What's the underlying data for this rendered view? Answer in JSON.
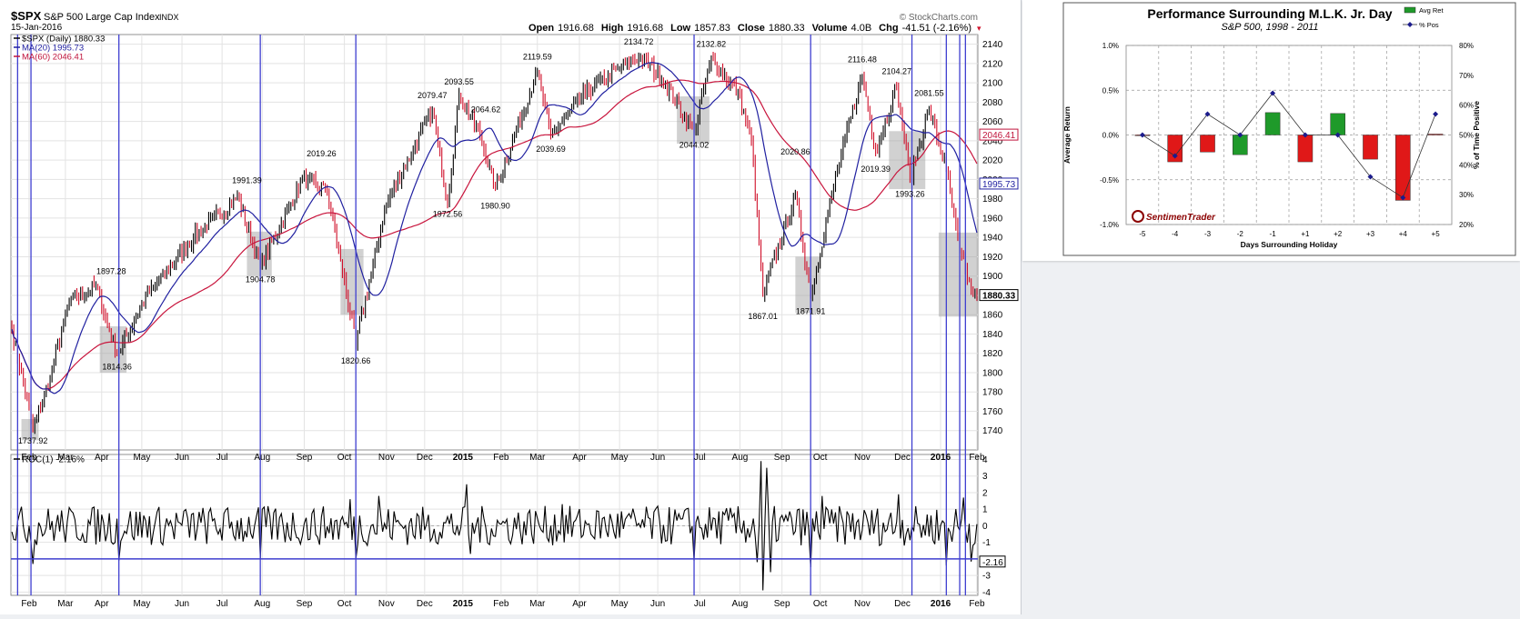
{
  "stockcharts": {
    "symbol": "$SPX",
    "name": "S&P 500 Large Cap Index",
    "exchange": "INDX",
    "date": "15-Jan-2016",
    "watermark": "© StockCharts.com",
    "quote": {
      "open_label": "Open",
      "open": "1916.68",
      "high_label": "High",
      "high": "1916.68",
      "low_label": "Low",
      "low": "1857.83",
      "close_label": "Close",
      "close": "1880.33",
      "volume_label": "Volume",
      "volume": "4.0B",
      "chg_label": "Chg",
      "chg": "-41.51 (-2.16%)"
    },
    "legend": [
      {
        "text": "$SPX (Daily) 1880.33",
        "color": "#000000"
      },
      {
        "text": "MA(20) 1995.73",
        "color": "#1f1fa0"
      },
      {
        "text": "MA(60) 2046.41",
        "color": "#c0143c"
      }
    ],
    "roc_label": "ROC(1) -2.16%",
    "value_tags": [
      {
        "text": "2046.41",
        "value": 2046.41,
        "color": "#c0143c"
      },
      {
        "text": "1995.73",
        "value": 1995.73,
        "color": "#1f1fa0"
      },
      {
        "text": "1880.33",
        "value": 1880.33,
        "color": "#000000"
      }
    ],
    "roc_tag": {
      "text": "-2.16",
      "value": -2.16
    },
    "price_axis": {
      "min": 1720,
      "max": 2150,
      "ticks": [
        2140,
        2120,
        2100,
        2080,
        2060,
        2040,
        2020,
        2000,
        1980,
        1960,
        1940,
        1920,
        1900,
        1880,
        1860,
        1840,
        1820,
        1800,
        1780,
        1760,
        1740
      ]
    },
    "roc_axis": {
      "min": -4.2,
      "max": 4.3,
      "ticks": [
        4,
        3,
        2,
        1,
        0,
        -1,
        -2,
        -3,
        -4
      ]
    },
    "x_labels": [
      {
        "text": "Feb",
        "idx": 9
      },
      {
        "text": "Mar",
        "idx": 28
      },
      {
        "text": "Apr",
        "idx": 47
      },
      {
        "text": "May",
        "idx": 68
      },
      {
        "text": "Jun",
        "idx": 89
      },
      {
        "text": "Jul",
        "idx": 110
      },
      {
        "text": "Aug",
        "idx": 131
      },
      {
        "text": "Sep",
        "idx": 153
      },
      {
        "text": "Oct",
        "idx": 174
      },
      {
        "text": "Nov",
        "idx": 196
      },
      {
        "text": "Dec",
        "idx": 216
      },
      {
        "text": "2015",
        "idx": 236,
        "bold": true
      },
      {
        "text": "Feb",
        "idx": 256
      },
      {
        "text": "Mar",
        "idx": 275
      },
      {
        "text": "Apr",
        "idx": 297
      },
      {
        "text": "May",
        "idx": 318
      },
      {
        "text": "Jun",
        "idx": 338
      },
      {
        "text": "Jul",
        "idx": 360
      },
      {
        "text": "Aug",
        "idx": 381
      },
      {
        "text": "Sep",
        "idx": 403
      },
      {
        "text": "Oct",
        "idx": 423
      },
      {
        "text": "Nov",
        "idx": 445
      },
      {
        "text": "Dec",
        "idx": 466
      },
      {
        "text": "2016",
        "idx": 486,
        "bold": true
      },
      {
        "text": "Feb",
        "idx": 505
      }
    ],
    "vertical_markers": [
      3,
      10,
      56,
      130,
      180,
      357,
      418,
      471,
      489,
      496,
      499
    ],
    "roc_hline": -2.0,
    "shaded_boxes": [
      {
        "i0": 5,
        "i1": 14,
        "lo": 1730,
        "hi": 1752
      },
      {
        "i0": 46,
        "i1": 60,
        "lo": 1800,
        "hi": 1848
      },
      {
        "i0": 123,
        "i1": 136,
        "lo": 1900,
        "hi": 1946
      },
      {
        "i0": 172,
        "i1": 184,
        "lo": 1860,
        "hi": 1928
      },
      {
        "i0": 348,
        "i1": 365,
        "lo": 2037,
        "hi": 2086
      },
      {
        "i0": 410,
        "i1": 423,
        "lo": 1862,
        "hi": 1920
      },
      {
        "i0": 459,
        "i1": 478,
        "lo": 1990,
        "hi": 2050
      },
      {
        "i0": 485,
        "i1": 505,
        "lo": 1858,
        "hi": 1945
      }
    ],
    "price_labels": [
      {
        "text": "1737.92",
        "idx": 11,
        "value": 1737.92,
        "pos": "below"
      },
      {
        "text": "1897.28",
        "idx": 52,
        "value": 1897.28,
        "pos": "above"
      },
      {
        "text": "1814.36",
        "idx": 55,
        "value": 1814.36,
        "pos": "below"
      },
      {
        "text": "1991.39",
        "idx": 123,
        "value": 1991.39,
        "pos": "above"
      },
      {
        "text": "1904.78",
        "idx": 130,
        "value": 1904.78,
        "pos": "below"
      },
      {
        "text": "2019.26",
        "idx": 162,
        "value": 2019.26,
        "pos": "above"
      },
      {
        "text": "1820.66",
        "idx": 180,
        "value": 1820.66,
        "pos": "below"
      },
      {
        "text": "2079.47",
        "idx": 220,
        "value": 2079.47,
        "pos": "above"
      },
      {
        "text": "1972.56",
        "idx": 228,
        "value": 1972.56,
        "pos": "below"
      },
      {
        "text": "2093.55",
        "idx": 234,
        "value": 2093.55,
        "pos": "above"
      },
      {
        "text": "2064.62",
        "idx": 248,
        "value": 2064.62,
        "pos": "above"
      },
      {
        "text": "1980.90",
        "idx": 253,
        "value": 1980.9,
        "pos": "below"
      },
      {
        "text": "2119.59",
        "idx": 275,
        "value": 2119.59,
        "pos": "above"
      },
      {
        "text": "2039.69",
        "idx": 282,
        "value": 2039.69,
        "pos": "below"
      },
      {
        "text": "2134.72",
        "idx": 328,
        "value": 2134.72,
        "pos": "above"
      },
      {
        "text": "2132.82",
        "idx": 366,
        "value": 2132.82,
        "pos": "above"
      },
      {
        "text": "2044.02",
        "idx": 357,
        "value": 2044.02,
        "pos": "below"
      },
      {
        "text": "1867.01",
        "idx": 393,
        "value": 1867.01,
        "pos": "below"
      },
      {
        "text": "2020.86",
        "idx": 410,
        "value": 2020.86,
        "pos": "above"
      },
      {
        "text": "1871.91",
        "idx": 418,
        "value": 1871.91,
        "pos": "below"
      },
      {
        "text": "2116.48",
        "idx": 445,
        "value": 2116.48,
        "pos": "above"
      },
      {
        "text": "2019.39",
        "idx": 452,
        "value": 2019.39,
        "pos": "below"
      },
      {
        "text": "2104.27",
        "idx": 463,
        "value": 2104.27,
        "pos": "above"
      },
      {
        "text": "2081.55",
        "idx": 480,
        "value": 2081.55,
        "pos": "above"
      },
      {
        "text": "1993.26",
        "idx": 470,
        "value": 1993.26,
        "pos": "below"
      }
    ],
    "colors": {
      "up": "#000000",
      "down": "#d0102a",
      "ma20": "#2020a0",
      "ma60": "#c8143c",
      "marker": "#3f3fd0",
      "grid": "#e3e3e3",
      "shade": "#9a9a9a"
    }
  },
  "chart_data": [
    {
      "type": "line",
      "title": "$SPX S&P 500 Large Cap Index",
      "x_range": [
        "Jan 2014",
        "Jan 2016"
      ],
      "ylim": [
        1720,
        2150
      ],
      "series": [
        {
          "name": "$SPX (Daily)",
          "last": 1880.33
        },
        {
          "name": "MA(20)",
          "last": 1995.73
        },
        {
          "name": "MA(60)",
          "last": 2046.41
        }
      ],
      "anchors": [
        {
          "idx": 0,
          "value": 1845
        },
        {
          "idx": 11,
          "value": 1741
        },
        {
          "idx": 20,
          "value": 1795
        },
        {
          "idx": 30,
          "value": 1872
        },
        {
          "idx": 44,
          "value": 1890
        },
        {
          "idx": 55,
          "value": 1818
        },
        {
          "idx": 70,
          "value": 1878
        },
        {
          "idx": 95,
          "value": 1940
        },
        {
          "idx": 118,
          "value": 1982
        },
        {
          "idx": 130,
          "value": 1910
        },
        {
          "idx": 152,
          "value": 2000
        },
        {
          "idx": 165,
          "value": 1988
        },
        {
          "idx": 180,
          "value": 1830
        },
        {
          "idx": 196,
          "value": 1975
        },
        {
          "idx": 220,
          "value": 2072
        },
        {
          "idx": 228,
          "value": 1976
        },
        {
          "idx": 234,
          "value": 2088
        },
        {
          "idx": 245,
          "value": 2045
        },
        {
          "idx": 253,
          "value": 1990
        },
        {
          "idx": 275,
          "value": 2112
        },
        {
          "idx": 282,
          "value": 2045
        },
        {
          "idx": 300,
          "value": 2090
        },
        {
          "idx": 328,
          "value": 2128
        },
        {
          "idx": 340,
          "value": 2105
        },
        {
          "idx": 357,
          "value": 2050
        },
        {
          "idx": 366,
          "value": 2125
        },
        {
          "idx": 380,
          "value": 2090
        },
        {
          "idx": 387,
          "value": 2040
        },
        {
          "idx": 393,
          "value": 1880
        },
        {
          "idx": 410,
          "value": 1985
        },
        {
          "idx": 418,
          "value": 1880
        },
        {
          "idx": 432,
          "value": 2010
        },
        {
          "idx": 445,
          "value": 2108
        },
        {
          "idx": 452,
          "value": 2030
        },
        {
          "idx": 463,
          "value": 2095
        },
        {
          "idx": 470,
          "value": 2002
        },
        {
          "idx": 480,
          "value": 2072
        },
        {
          "idx": 489,
          "value": 2010
        },
        {
          "idx": 496,
          "value": 1925
        },
        {
          "idx": 503,
          "value": 1880
        }
      ]
    },
    {
      "type": "line",
      "title": "ROC(1)",
      "ylim": [
        -4.2,
        4.3
      ],
      "series": [
        {
          "name": "ROC(1)",
          "last": -2.16
        }
      ],
      "spikes": [
        {
          "idx": 11,
          "value": -2.3
        },
        {
          "idx": 56,
          "value": -2.1
        },
        {
          "idx": 130,
          "value": -2.0
        },
        {
          "idx": 177,
          "value": 1.6
        },
        {
          "idx": 180,
          "value": -2.0
        },
        {
          "idx": 192,
          "value": 1.8
        },
        {
          "idx": 238,
          "value": 2.5
        },
        {
          "idx": 240,
          "value": -1.7
        },
        {
          "idx": 288,
          "value": 1.3
        },
        {
          "idx": 357,
          "value": -2.1
        },
        {
          "idx": 390,
          "value": -2.2
        },
        {
          "idx": 392,
          "value": 3.9
        },
        {
          "idx": 393,
          "value": -3.9
        },
        {
          "idx": 395,
          "value": 3.5
        },
        {
          "idx": 397,
          "value": -2.8
        },
        {
          "idx": 418,
          "value": -2.5
        },
        {
          "idx": 424,
          "value": 1.8
        },
        {
          "idx": 464,
          "value": 1.9
        },
        {
          "idx": 489,
          "value": -2.4
        },
        {
          "idx": 498,
          "value": 1.7
        },
        {
          "idx": 502,
          "value": -2.16
        }
      ]
    },
    {
      "type": "bar",
      "title": "Performance Surrounding M.L.K. Jr. Day",
      "subtitle": "S&P 500, 1998 - 2011",
      "xlabel": "Days Surrounding Holiday",
      "ylabel": "Average Return",
      "y2label": "% of Time Positive",
      "categories": [
        "-5",
        "-4",
        "-3",
        "-2",
        "-1",
        "+1",
        "+2",
        "+3",
        "+4",
        "+5"
      ],
      "ylim": [
        -1.0,
        1.0
      ],
      "y2lim": [
        20,
        80
      ],
      "yticks": [
        "1.0%",
        "0.5%",
        "0.0%",
        "-0.5%",
        "-1.0%"
      ],
      "y2ticks": [
        "80%",
        "70%",
        "60%",
        "50%",
        "40%",
        "30%",
        "20%"
      ],
      "series": [
        {
          "name": "Avg Ret",
          "values": [
            0.0,
            -0.3,
            -0.19,
            -0.22,
            0.25,
            -0.3,
            0.24,
            -0.27,
            -0.73,
            0.01
          ]
        },
        {
          "name": "% Pos",
          "values": [
            50,
            43,
            57,
            50,
            64,
            50,
            50,
            36,
            29,
            57
          ]
        }
      ],
      "legend": "top-right",
      "logo": "SentimenTrader"
    }
  ]
}
